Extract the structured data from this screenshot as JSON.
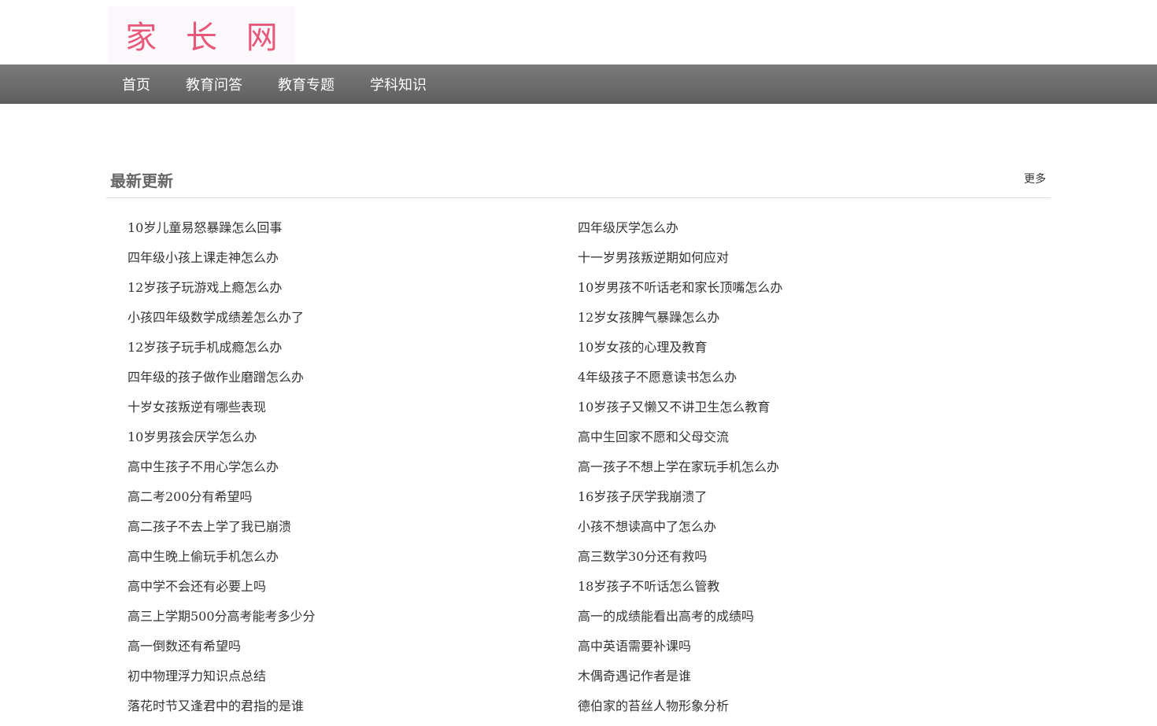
{
  "logo": {
    "text": "家 长 网"
  },
  "nav": {
    "items": [
      "首页",
      "教育问答",
      "教育专题",
      "学科知识"
    ]
  },
  "latest": {
    "title": "最新更新",
    "more": "更多",
    "items": [
      "10岁儿童易怒暴躁怎么回事",
      "四年级厌学怎么办",
      "四年级小孩上课走神怎么办",
      "十一岁男孩叛逆期如何应对",
      "12岁孩子玩游戏上瘾怎么办",
      "10岁男孩不听话老和家长顶嘴怎么办",
      "小孩四年级数学成绩差怎么办了",
      "12岁女孩脾气暴躁怎么办",
      "12岁孩子玩手机成瘾怎么办",
      "10岁女孩的心理及教育",
      "四年级的孩子做作业磨蹭怎么办",
      "4年级孩子不愿意读书怎么办",
      "十岁女孩叛逆有哪些表现",
      "10岁孩子又懒又不讲卫生怎么教育",
      "10岁男孩会厌学怎么办",
      "高中生回家不愿和父母交流",
      "高中生孩子不用心学怎么办",
      "高一孩子不想上学在家玩手机怎么办",
      "高二考200分有希望吗",
      "16岁孩子厌学我崩溃了",
      "高二孩子不去上学了我已崩溃",
      "小孩不想读高中了怎么办",
      "高中生晚上偷玩手机怎么办",
      "高三数学30分还有救吗",
      "高中学不会还有必要上吗",
      "18岁孩子不听话怎么管教",
      "高三上学期500分高考能考多少分",
      "高一的成绩能看出高考的成绩吗",
      "高一倒数还有希望吗",
      "高中英语需要补课吗",
      "初中物理浮力知识点总结",
      "木偶奇遇记作者是谁",
      "落花时节又逢君中的君指的是谁",
      "德伯家的苔丝人物形象分析"
    ]
  }
}
